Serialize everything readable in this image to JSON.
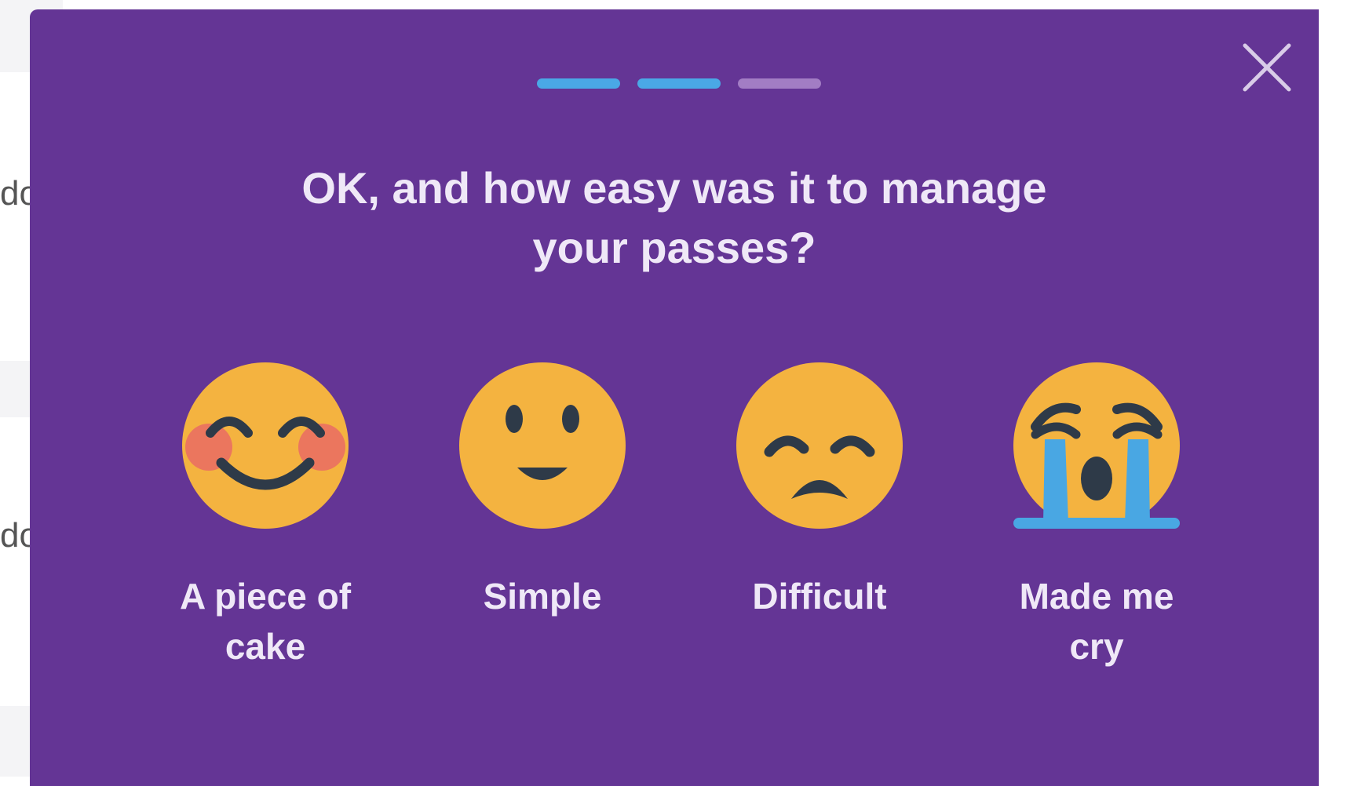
{
  "background": {
    "fragments": [
      "do",
      "do"
    ]
  },
  "survey": {
    "progress": {
      "total_steps": 3,
      "current_step": 2,
      "active_color": "#4aa8e6",
      "inactive_color": "#a27dc4"
    },
    "question_line1": "OK, and how easy was it to manage",
    "question_line2": "your passes?",
    "close_icon": "close-icon",
    "options": [
      {
        "label_line1": "A piece of",
        "label_line2": "cake",
        "icon": "blushing-smile-emoji-icon"
      },
      {
        "label_line1": "Simple",
        "label_line2": "",
        "icon": "slight-smile-emoji-icon"
      },
      {
        "label_line1": "Difficult",
        "label_line2": "",
        "icon": "disappointed-emoji-icon"
      },
      {
        "label_line1": "Made me",
        "label_line2": "cry",
        "icon": "loudly-crying-emoji-icon"
      }
    ]
  },
  "colors": {
    "modal_background": "#643595",
    "text": "#efe8f7",
    "emoji_face": "#f4b340",
    "emoji_features": "#2e3a48",
    "blush": "#ea6f62",
    "tears": "#49a7e3"
  }
}
